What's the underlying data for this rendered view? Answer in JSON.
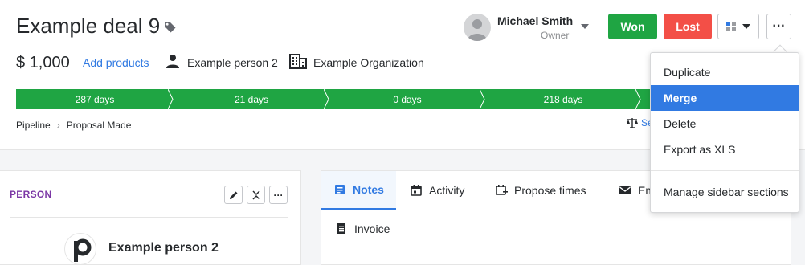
{
  "deal": {
    "title": "Example deal 9",
    "value": "$ 1,000",
    "add_products": "Add products",
    "person": "Example person 2",
    "organization": "Example Organization"
  },
  "owner": {
    "name": "Michael Smith",
    "role": "Owner"
  },
  "actions": {
    "won": "Won",
    "lost": "Lost",
    "more": "···"
  },
  "pipeline": {
    "stages": [
      "287 days",
      "21 days",
      "0 days",
      "218 days",
      ""
    ]
  },
  "breadcrumb": {
    "pipeline": "Pipeline",
    "stage": "Proposal Made"
  },
  "partial_link": "Se",
  "person_panel": {
    "title": "PERSON",
    "name": "Example person 2"
  },
  "tabs": {
    "notes": "Notes",
    "activity": "Activity",
    "propose_times": "Propose times",
    "email": "Em",
    "invoice": "Invoice"
  },
  "menu": {
    "items": [
      "Duplicate",
      "Merge",
      "Delete",
      "Export as XLS"
    ],
    "footer": "Manage sidebar sections",
    "highlighted": "Merge"
  },
  "colors": {
    "won": "#1fa543",
    "lost": "#f34f47",
    "accent": "#317ae2",
    "person_title": "#7b37a5"
  }
}
